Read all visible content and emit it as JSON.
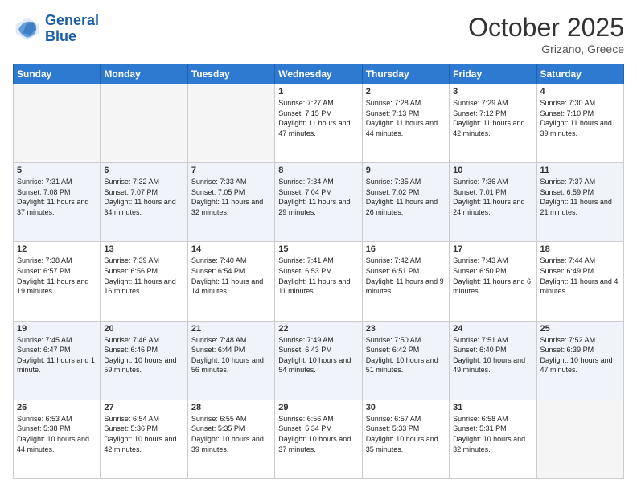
{
  "header": {
    "logo_line1": "General",
    "logo_line2": "Blue",
    "month": "October 2025",
    "location": "Grizano, Greece"
  },
  "weekdays": [
    "Sunday",
    "Monday",
    "Tuesday",
    "Wednesday",
    "Thursday",
    "Friday",
    "Saturday"
  ],
  "weeks": [
    [
      {
        "day": "",
        "info": ""
      },
      {
        "day": "",
        "info": ""
      },
      {
        "day": "",
        "info": ""
      },
      {
        "day": "1",
        "info": "Sunrise: 7:27 AM\nSunset: 7:15 PM\nDaylight: 11 hours and 47 minutes."
      },
      {
        "day": "2",
        "info": "Sunrise: 7:28 AM\nSunset: 7:13 PM\nDaylight: 11 hours and 44 minutes."
      },
      {
        "day": "3",
        "info": "Sunrise: 7:29 AM\nSunset: 7:12 PM\nDaylight: 11 hours and 42 minutes."
      },
      {
        "day": "4",
        "info": "Sunrise: 7:30 AM\nSunset: 7:10 PM\nDaylight: 11 hours and 39 minutes."
      }
    ],
    [
      {
        "day": "5",
        "info": "Sunrise: 7:31 AM\nSunset: 7:08 PM\nDaylight: 11 hours and 37 minutes."
      },
      {
        "day": "6",
        "info": "Sunrise: 7:32 AM\nSunset: 7:07 PM\nDaylight: 11 hours and 34 minutes."
      },
      {
        "day": "7",
        "info": "Sunrise: 7:33 AM\nSunset: 7:05 PM\nDaylight: 11 hours and 32 minutes."
      },
      {
        "day": "8",
        "info": "Sunrise: 7:34 AM\nSunset: 7:04 PM\nDaylight: 11 hours and 29 minutes."
      },
      {
        "day": "9",
        "info": "Sunrise: 7:35 AM\nSunset: 7:02 PM\nDaylight: 11 hours and 26 minutes."
      },
      {
        "day": "10",
        "info": "Sunrise: 7:36 AM\nSunset: 7:01 PM\nDaylight: 11 hours and 24 minutes."
      },
      {
        "day": "11",
        "info": "Sunrise: 7:37 AM\nSunset: 6:59 PM\nDaylight: 11 hours and 21 minutes."
      }
    ],
    [
      {
        "day": "12",
        "info": "Sunrise: 7:38 AM\nSunset: 6:57 PM\nDaylight: 11 hours and 19 minutes."
      },
      {
        "day": "13",
        "info": "Sunrise: 7:39 AM\nSunset: 6:56 PM\nDaylight: 11 hours and 16 minutes."
      },
      {
        "day": "14",
        "info": "Sunrise: 7:40 AM\nSunset: 6:54 PM\nDaylight: 11 hours and 14 minutes."
      },
      {
        "day": "15",
        "info": "Sunrise: 7:41 AM\nSunset: 6:53 PM\nDaylight: 11 hours and 11 minutes."
      },
      {
        "day": "16",
        "info": "Sunrise: 7:42 AM\nSunset: 6:51 PM\nDaylight: 11 hours and 9 minutes."
      },
      {
        "day": "17",
        "info": "Sunrise: 7:43 AM\nSunset: 6:50 PM\nDaylight: 11 hours and 6 minutes."
      },
      {
        "day": "18",
        "info": "Sunrise: 7:44 AM\nSunset: 6:49 PM\nDaylight: 11 hours and 4 minutes."
      }
    ],
    [
      {
        "day": "19",
        "info": "Sunrise: 7:45 AM\nSunset: 6:47 PM\nDaylight: 11 hours and 1 minute."
      },
      {
        "day": "20",
        "info": "Sunrise: 7:46 AM\nSunset: 6:46 PM\nDaylight: 10 hours and 59 minutes."
      },
      {
        "day": "21",
        "info": "Sunrise: 7:48 AM\nSunset: 6:44 PM\nDaylight: 10 hours and 56 minutes."
      },
      {
        "day": "22",
        "info": "Sunrise: 7:49 AM\nSunset: 6:43 PM\nDaylight: 10 hours and 54 minutes."
      },
      {
        "day": "23",
        "info": "Sunrise: 7:50 AM\nSunset: 6:42 PM\nDaylight: 10 hours and 51 minutes."
      },
      {
        "day": "24",
        "info": "Sunrise: 7:51 AM\nSunset: 6:40 PM\nDaylight: 10 hours and 49 minutes."
      },
      {
        "day": "25",
        "info": "Sunrise: 7:52 AM\nSunset: 6:39 PM\nDaylight: 10 hours and 47 minutes."
      }
    ],
    [
      {
        "day": "26",
        "info": "Sunrise: 6:53 AM\nSunset: 5:38 PM\nDaylight: 10 hours and 44 minutes."
      },
      {
        "day": "27",
        "info": "Sunrise: 6:54 AM\nSunset: 5:36 PM\nDaylight: 10 hours and 42 minutes."
      },
      {
        "day": "28",
        "info": "Sunrise: 6:55 AM\nSunset: 5:35 PM\nDaylight: 10 hours and 39 minutes."
      },
      {
        "day": "29",
        "info": "Sunrise: 6:56 AM\nSunset: 5:34 PM\nDaylight: 10 hours and 37 minutes."
      },
      {
        "day": "30",
        "info": "Sunrise: 6:57 AM\nSunset: 5:33 PM\nDaylight: 10 hours and 35 minutes."
      },
      {
        "day": "31",
        "info": "Sunrise: 6:58 AM\nSunset: 5:31 PM\nDaylight: 10 hours and 32 minutes."
      },
      {
        "day": "",
        "info": ""
      }
    ]
  ]
}
